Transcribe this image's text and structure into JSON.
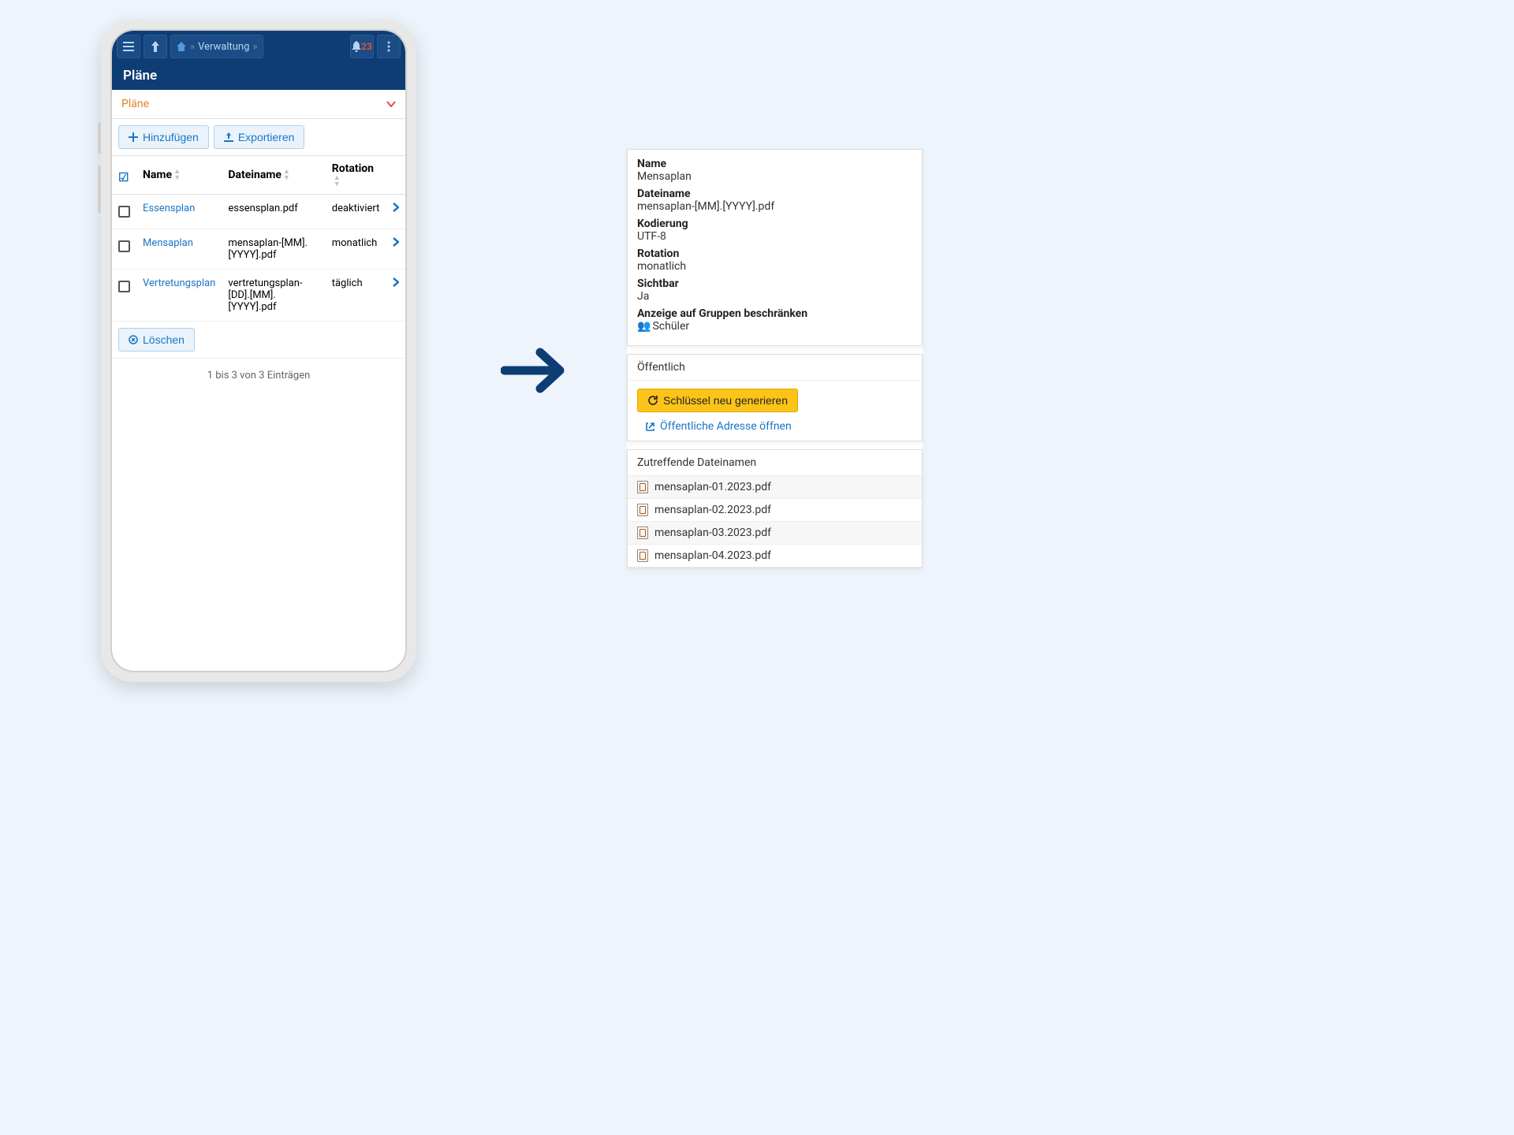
{
  "header": {
    "breadcrumb": "Verwaltung",
    "notification_count": "23",
    "title": "Pläne"
  },
  "section": {
    "title": "Pläne"
  },
  "actions": {
    "add": "Hinzufügen",
    "export": "Exportieren",
    "delete": "Löschen"
  },
  "table": {
    "columns": {
      "name": "Name",
      "filename": "Dateiname",
      "rotation": "Rotation"
    },
    "rows": [
      {
        "name": "Essensplan",
        "filename": "essensplan.pdf",
        "rotation": "deaktiviert"
      },
      {
        "name": "Mensaplan",
        "filename": "mensaplan-[MM].[YYYY].pdf",
        "rotation": "monatlich"
      },
      {
        "name": "Vertretungsplan",
        "filename": "vertretungsplan-[DD].[MM].[YYYY].pdf",
        "rotation": "täglich"
      }
    ],
    "footer": "1 bis 3 von 3 Einträgen"
  },
  "detail": {
    "fields": {
      "name_label": "Name",
      "name_value": "Mensaplan",
      "filename_label": "Dateiname",
      "filename_value": "mensaplan-[MM].[YYYY].pdf",
      "encoding_label": "Kodierung",
      "encoding_value": "UTF-8",
      "rotation_label": "Rotation",
      "rotation_value": "monatlich",
      "visible_label": "Sichtbar",
      "visible_value": "Ja",
      "groups_label": "Anzeige auf Gruppen beschränken",
      "groups_value": "Schüler"
    },
    "public": {
      "header": "Öffentlich",
      "regen_key": "Schlüssel neu generieren",
      "open_url": "Öffentliche Adresse öffnen"
    },
    "filenames": {
      "header": "Zutreffende Dateinamen",
      "items": [
        "mensaplan-01.2023.pdf",
        "mensaplan-02.2023.pdf",
        "mensaplan-03.2023.pdf",
        "mensaplan-04.2023.pdf"
      ]
    }
  }
}
